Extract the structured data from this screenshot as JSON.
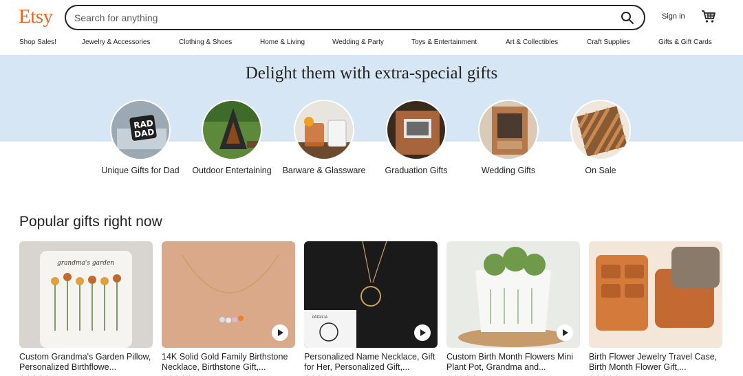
{
  "brand": {
    "logo": "Etsy",
    "accent": "#f1641e"
  },
  "search": {
    "placeholder": "Search for anything",
    "value": ""
  },
  "header": {
    "signin_label": "Sign in"
  },
  "nav": [
    "Shop Sales!",
    "Jewelry & Accessories",
    "Clothing & Shoes",
    "Home & Living",
    "Wedding & Party",
    "Toys & Entertainment",
    "Art & Collectibles",
    "Craft Supplies",
    "Gifts & Gift Cards"
  ],
  "hero": {
    "title": "Delight them with extra-special gifts",
    "band_color": "#d7e6f5"
  },
  "categories": [
    {
      "label": "Unique Gifts for Dad"
    },
    {
      "label": "Outdoor Entertaining"
    },
    {
      "label": "Barware & Glassware"
    },
    {
      "label": "Graduation Gifts"
    },
    {
      "label": "Wedding Gifts"
    },
    {
      "label": "On Sale"
    }
  ],
  "popular": {
    "title": "Popular gifts right now",
    "items": [
      {
        "title": "Custom Grandma's Garden Pillow, Personalized Birthflowe...",
        "has_video": false
      },
      {
        "title": "14K Solid Gold Family Birthstone Necklace, Birthstone Gift,...",
        "has_video": true
      },
      {
        "title": "Personalized Name Necklace, Gift for Her, Personalized Gift,...",
        "has_video": true
      },
      {
        "title": "Custom Birth Month Flowers Mini Plant Pot, Grandma and...",
        "has_video": true
      },
      {
        "title": "Birth Flower Jewelry Travel Case, Birth Month Flower Gift,...",
        "has_video": false
      }
    ]
  }
}
